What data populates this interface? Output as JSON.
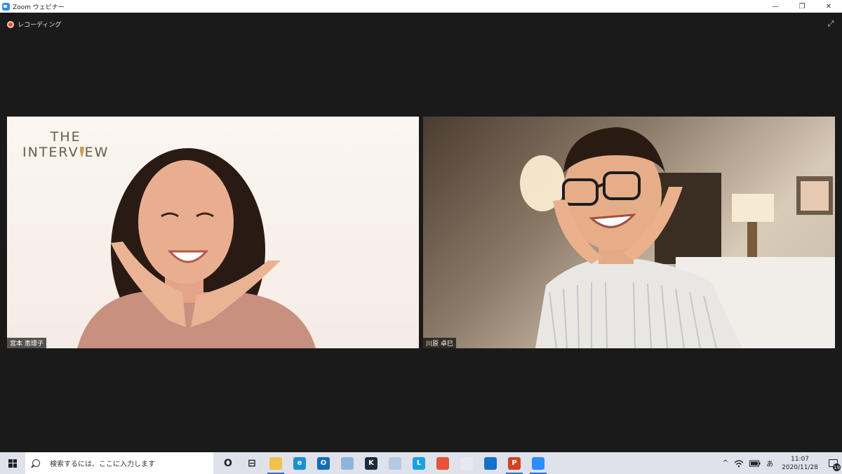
{
  "window": {
    "title": "Zoom ウェビナー",
    "controls": {
      "minimize": "—",
      "restore": "❐",
      "close": "✕"
    }
  },
  "meeting": {
    "recording_label": "レコーディング",
    "participants": [
      {
        "name": "宮本 恵理子",
        "logo_line1": "THE",
        "logo_line2_a": "INTERV",
        "logo_line2_b": "EW"
      },
      {
        "name": "川原 卓巳"
      }
    ]
  },
  "taskbar": {
    "search_placeholder": "検索するには、ここに入力します",
    "apps": [
      {
        "icon": "cortana-icon",
        "label": "O"
      },
      {
        "icon": "task-view-icon",
        "label": "⊟"
      },
      {
        "icon": "file-explorer-icon",
        "label": "",
        "color": "#f0c24b",
        "active": true
      },
      {
        "icon": "edge-icon",
        "label": "e",
        "color": "#1b8fd6"
      },
      {
        "icon": "outlook-icon",
        "label": "O",
        "color": "#0f6cbd"
      },
      {
        "icon": "app-icon",
        "label": "",
        "color": "#8fb4d9"
      },
      {
        "icon": "kindle-icon",
        "label": "K",
        "color": "#1f2b3a"
      },
      {
        "icon": "paint-icon",
        "label": "",
        "color": "#b6c9e0"
      },
      {
        "icon": "l-app-icon",
        "label": "L",
        "color": "#1aa0e8"
      },
      {
        "icon": "chrome-icon",
        "label": "",
        "color": "#e6533c"
      },
      {
        "icon": "snip-icon",
        "label": "",
        "color": "#e8e8f0"
      },
      {
        "icon": "mail-icon",
        "label": "",
        "color": "#1570c8"
      },
      {
        "icon": "powerpoint-icon",
        "label": "P",
        "color": "#d04423",
        "active": true
      },
      {
        "icon": "zoom-icon",
        "label": "",
        "color": "#2d8cff",
        "active": true
      }
    ],
    "tray": {
      "chevron": "^",
      "ime": "あ",
      "time": "11:07",
      "date": "2020/11/28",
      "notification_count": "19"
    }
  }
}
